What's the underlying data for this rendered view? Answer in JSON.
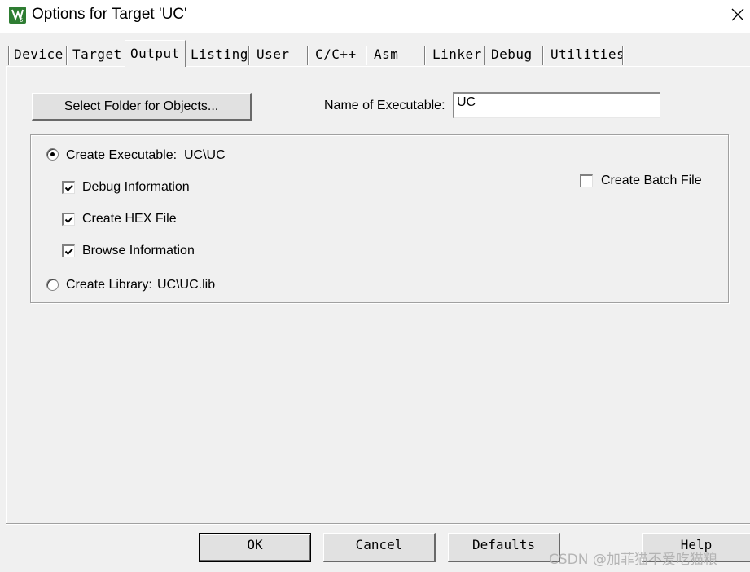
{
  "window": {
    "title": "Options for Target 'UC'",
    "app_icon": "uvision-icon",
    "close_icon": "close-icon"
  },
  "tabs": [
    {
      "label": "Device",
      "active": false
    },
    {
      "label": "Target",
      "active": false
    },
    {
      "label": "Output",
      "active": true
    },
    {
      "label": "Listing",
      "active": false
    },
    {
      "label": "User",
      "active": false
    },
    {
      "label": "C/C++",
      "active": false
    },
    {
      "label": "Asm",
      "active": false
    },
    {
      "label": "Linker",
      "active": false
    },
    {
      "label": "Debug",
      "active": false
    },
    {
      "label": "Utilities",
      "active": false
    }
  ],
  "output": {
    "select_folder_label": "Select Folder for Objects...",
    "name_of_executable_label": "Name of Executable:",
    "name_of_executable_value": "UC",
    "create_executable": {
      "label": "Create Executable:",
      "path": "UC\\UC",
      "selected": true
    },
    "debug_information": {
      "label": "Debug Information",
      "checked": true
    },
    "create_hex_file": {
      "label": "Create HEX File",
      "checked": true
    },
    "browse_information": {
      "label": "Browse Information",
      "checked": true
    },
    "create_library": {
      "label": "Create Library:",
      "path": "UC\\UC.lib",
      "selected": false
    },
    "create_batch_file": {
      "label": "Create Batch File",
      "checked": false
    }
  },
  "footer": {
    "ok_label": "OK",
    "cancel_label": "Cancel",
    "defaults_label": "Defaults",
    "help_label": "Help"
  },
  "watermark": "CSDN @加菲猫不爱吃猫粮",
  "colors": {
    "dialog_bg": "#f0f0f0",
    "titlebar_bg": "#ffffff",
    "icon_green": "#2e7d32"
  }
}
